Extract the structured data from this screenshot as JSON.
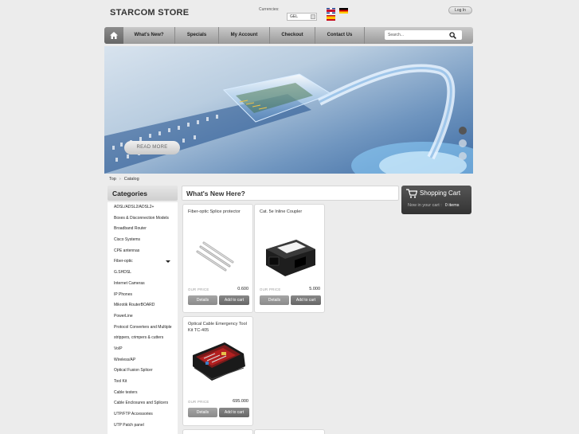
{
  "store": {
    "logo": "STARCOM STORE"
  },
  "currency": {
    "label": "Currencies:",
    "selected": "GEL"
  },
  "flags": [
    "uk-flag-icon",
    "germany-flag-icon",
    "spain-flag-icon"
  ],
  "login_label": "Log In",
  "nav": {
    "items": [
      "What's New?",
      "Specials",
      "My Account",
      "Checkout",
      "Contact Us"
    ],
    "search_placeholder": "Search..."
  },
  "banner": {
    "read_more": "READ MORE"
  },
  "breadcrumb": [
    "Top",
    "Catalog"
  ],
  "sidebar": {
    "title": "Categories",
    "items": [
      "ADSL/ADSL2/ADSL2+",
      "Boxes & Disconnection Models",
      "Broadband Router",
      "Cisco Systems",
      "CPE antennas",
      "Fiber-optic",
      "G.SHDSL",
      "Internet Cameras",
      "IP Phones",
      "Mikrotik RouterBOARD",
      "PowerLine",
      "Protocol Converters and Multiple",
      "strippers, crimpers & cutters",
      "VoIP",
      "Wireless/AP",
      "Optical Fusion Splicer",
      "Tool Kit",
      "Cable testers",
      "Cable Enclosures and Splicers",
      "UTP/FTP Accessories",
      "UTP Patch panel"
    ]
  },
  "main": {
    "title": "What's New Here?",
    "price_label": "OUR PRICE",
    "details_label": "Details",
    "add_label": "Add to cart",
    "products": [
      {
        "name": "Fiber-optic Splice protector",
        "price": "0.600"
      },
      {
        "name": "Cat. 5e Inline Coupler",
        "price": "5.000"
      },
      {
        "name": "Optical Cable Emergency Tool Kit TC-405",
        "price": "695.000"
      }
    ]
  },
  "cart": {
    "title": "Shopping Cart",
    "status": "Now in your cart :",
    "count": "0 items"
  },
  "colors": {
    "nav": "#b5b5b5",
    "cart_bg": "#444444",
    "accent": "#3c6aa2"
  }
}
